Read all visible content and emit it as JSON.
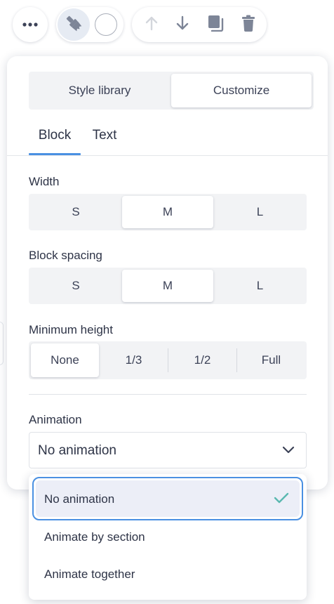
{
  "toolbar": {
    "more_icon": "more-horizontal-icon",
    "style_icon": "paintbrush-icon",
    "move_up_icon": "arrow-up-icon",
    "move_down_icon": "arrow-down-icon",
    "duplicate_icon": "duplicate-icon",
    "delete_icon": "trash-icon"
  },
  "panel": {
    "mode_tabs": [
      {
        "label": "Style library",
        "active": false
      },
      {
        "label": "Customize",
        "active": true
      }
    ],
    "sub_tabs": [
      {
        "label": "Block",
        "active": true
      },
      {
        "label": "Text",
        "active": false
      }
    ],
    "width": {
      "label": "Width",
      "options": [
        "S",
        "M",
        "L"
      ],
      "selected": "M"
    },
    "block_spacing": {
      "label": "Block spacing",
      "options": [
        "S",
        "M",
        "L"
      ],
      "selected": "M"
    },
    "minimum_height": {
      "label": "Minimum height",
      "options": [
        "None",
        "1/3",
        "1/2",
        "Full"
      ],
      "selected": "None"
    },
    "animation": {
      "label": "Animation",
      "value": "No animation"
    }
  },
  "animation_dropdown": {
    "options": [
      "No animation",
      "Animate by section",
      "Animate together"
    ],
    "selected": "No animation"
  },
  "colors": {
    "accent": "#4a90e2",
    "check": "#5ab8b0",
    "icon_active": "#7d8597",
    "icon_disabled": "#d3d6dc",
    "segment_bg": "#f2f3f5"
  }
}
